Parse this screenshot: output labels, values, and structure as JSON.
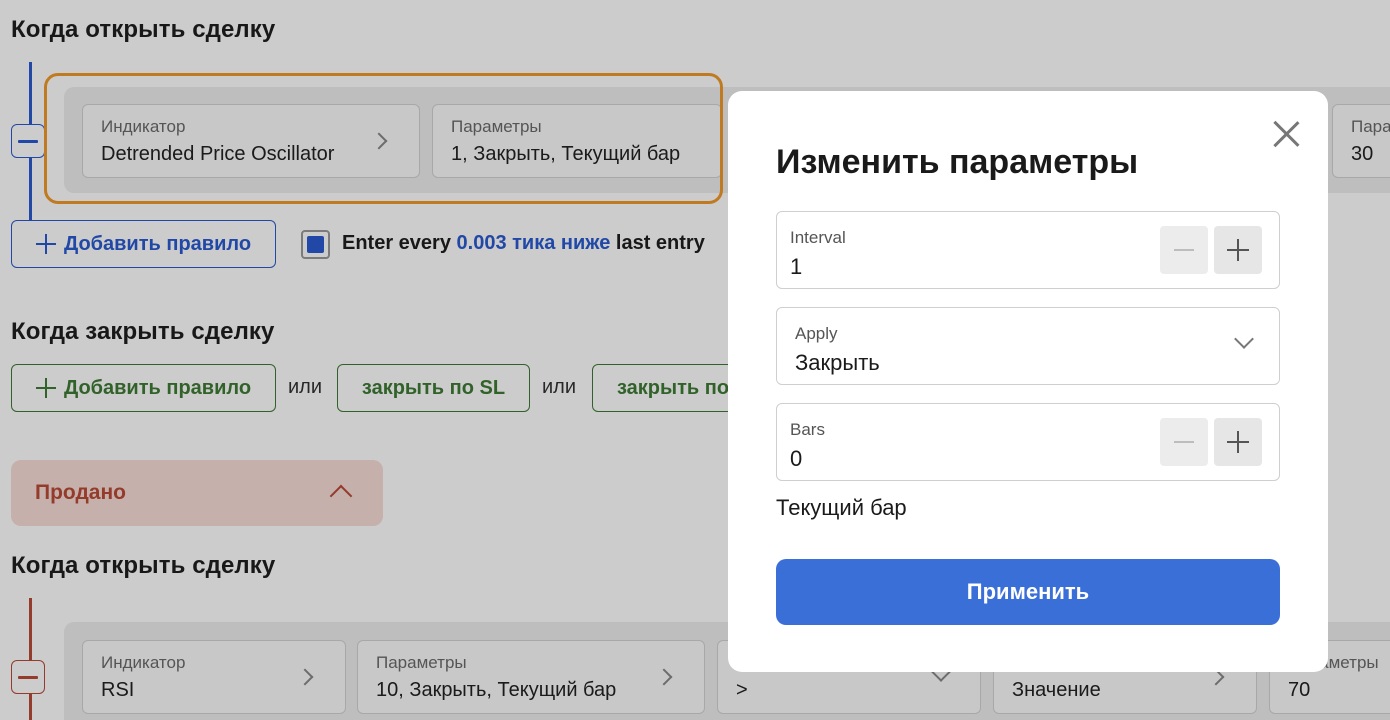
{
  "background": {
    "section1_title": "Когда открыть сделку",
    "rule1": {
      "indicator_label": "Индикатор",
      "indicator_value": "Detrended Price Oscillator",
      "params_label": "Параметры",
      "params_value": "1, Закрыть, Текущий бар",
      "partial_params_label": "Пара",
      "partial_params_value": "30"
    },
    "add_rule_label": "Добавить правило",
    "enter_every": {
      "prefix": "Enter every ",
      "link": "0.003 тика ниже",
      "suffix": " last entry",
      "checked": true
    },
    "section2_title": "Когда закрыть сделку",
    "close_add_rule_label": "Добавить правило",
    "or_label_1": "или",
    "close_sl_label": "закрыть по SL",
    "or_label_2": "или",
    "close_partial_label": "закрыть по",
    "sold_panel_label": "Продано",
    "section3_title": "Когда открыть сделку",
    "rule2": {
      "indicator_label": "Индикатор",
      "indicator_value": "RSI",
      "params_label": "Параметры",
      "params_value": "10, Закрыть, Текущий бар",
      "comparator_value": ">",
      "value_label": "Значение",
      "partial_params_label": "Параметры",
      "partial_params_value": "70"
    }
  },
  "modal": {
    "title": "Изменить параметры",
    "fields": [
      {
        "label": "Interval",
        "value": "1",
        "type": "stepper"
      },
      {
        "label": "Apply",
        "value": "Закрыть",
        "type": "select"
      },
      {
        "label": "Bars",
        "value": "0",
        "type": "stepper"
      }
    ],
    "bars_hint": "Текущий бар",
    "apply_button": "Применить"
  },
  "colors": {
    "accent_blue": "#3b6fd8",
    "buy_blue": "#2a5bd0",
    "sell_red": "#b94a36",
    "close_green": "#3e7b34",
    "highlight_orange": "#f09a2a"
  },
  "icons": [
    "minus-icon",
    "chevron-right-icon",
    "chevron-down-icon",
    "chevron-up-icon",
    "plus-icon",
    "close-icon"
  ]
}
